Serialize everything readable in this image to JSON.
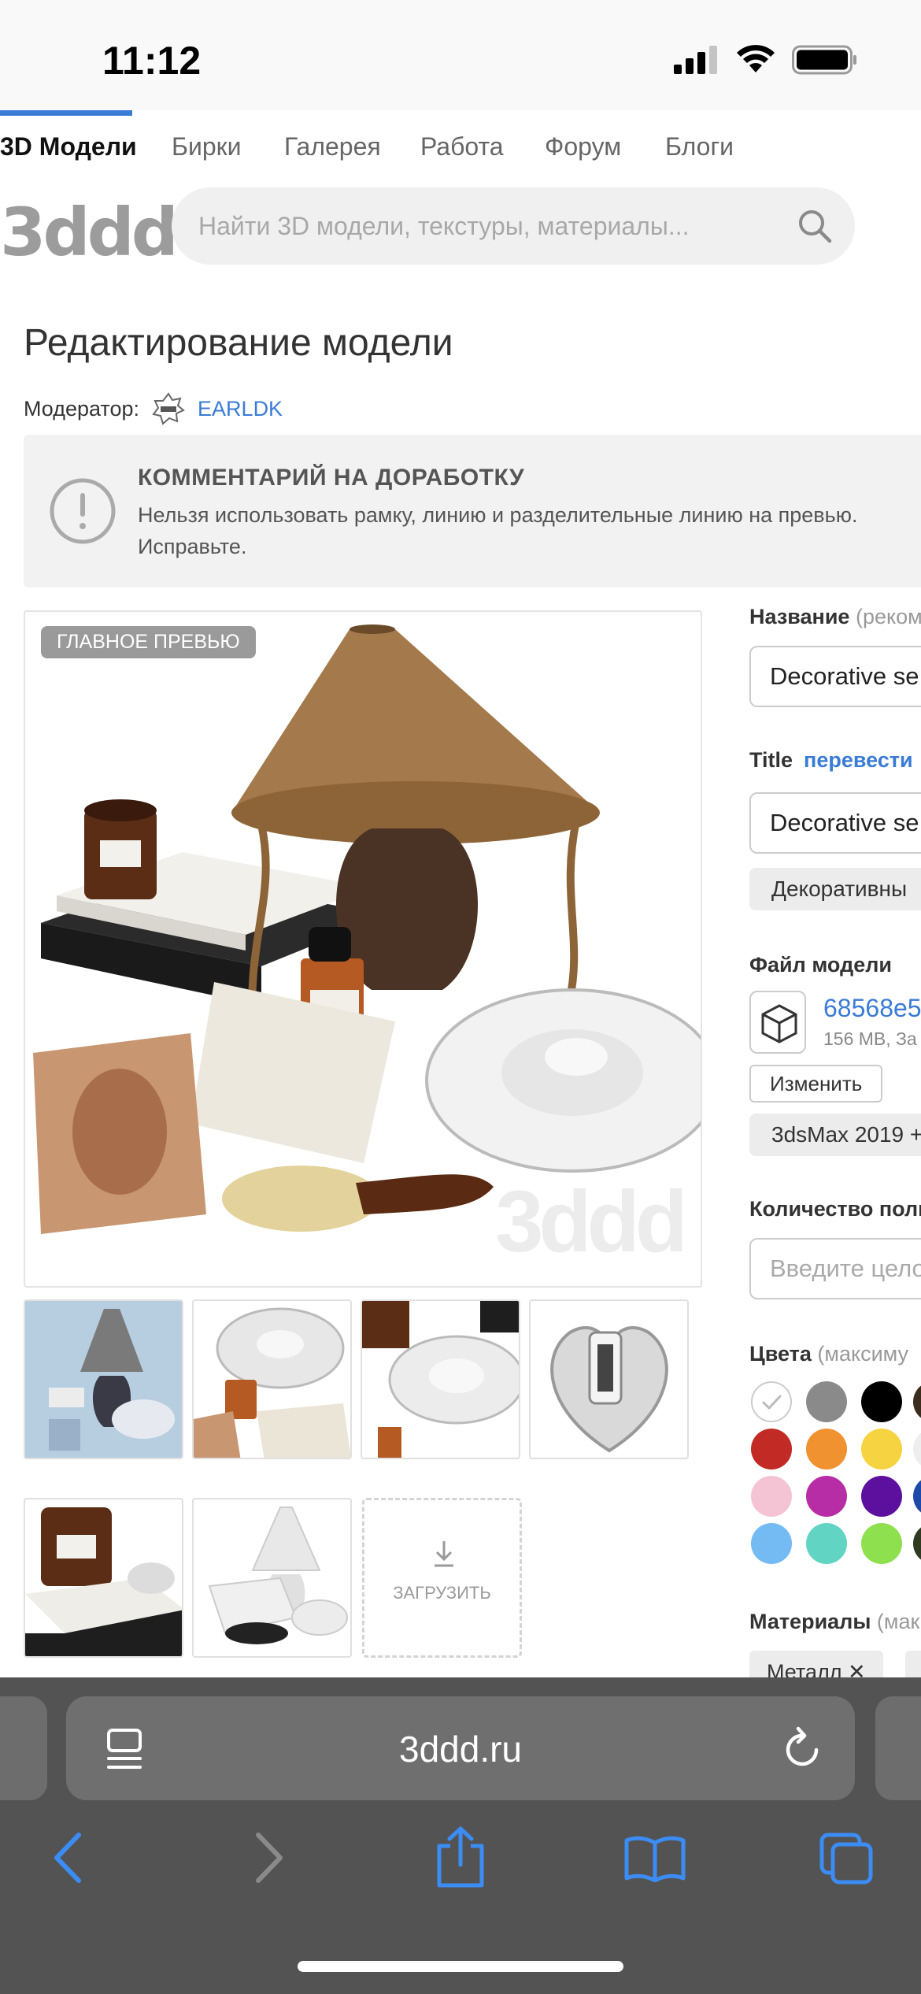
{
  "status": {
    "time": "11:12"
  },
  "nav": {
    "tabs": [
      {
        "label": "3D Модели",
        "active": true
      },
      {
        "label": "Бирки"
      },
      {
        "label": "Галерея"
      },
      {
        "label": "Работа"
      },
      {
        "label": "Форум"
      },
      {
        "label": "Блоги"
      }
    ]
  },
  "header": {
    "logo": "3ddd",
    "search_placeholder": "Найти 3D модели, текстуры, материалы..."
  },
  "page": {
    "title": "Редактирование модели",
    "moderator_label": "Модератор:",
    "moderator_name": "EARLDK"
  },
  "comment": {
    "title": "КОММЕНТАРИЙ НА ДОРАБОТКУ",
    "text": "Нельзя использовать рамку, линию и разделительные линию на превью. Исправьте."
  },
  "preview": {
    "badge": "ГЛАВНОЕ ПРЕВЬЮ",
    "watermark": "3ddd",
    "upload_label": "ЗАГРУЗИТЬ"
  },
  "form": {
    "name_label": "Название",
    "name_hint": "(реком",
    "name_value": "Decorative se",
    "title_label": "Title",
    "translate_link": "перевести",
    "title_value": "Decorative se",
    "category_chip": "Декоративны",
    "file_label": "Файл модели",
    "file_name": "68568e5",
    "file_info": "156 MB, За",
    "change_button": "Изменить",
    "software_chip": "3dsMax 2019 +",
    "polys_label": "Количество поли",
    "polys_placeholder": "Введите целое",
    "colors_label": "Цвета",
    "colors_hint": "(максиму",
    "colors": [
      "#ffffff",
      "#8a8a8a",
      "#000000",
      "#c22b25",
      "#f0922f",
      "#f6d441",
      "#f5c4d4",
      "#b72da5",
      "#5d0f9e",
      "#74baf3",
      "#62d4c4",
      "#8fe04f"
    ],
    "materials_label": "Материалы",
    "materials_hint": "(мак",
    "material_chip": "Металл ✕"
  },
  "browser": {
    "url": "3ddd.ru"
  }
}
